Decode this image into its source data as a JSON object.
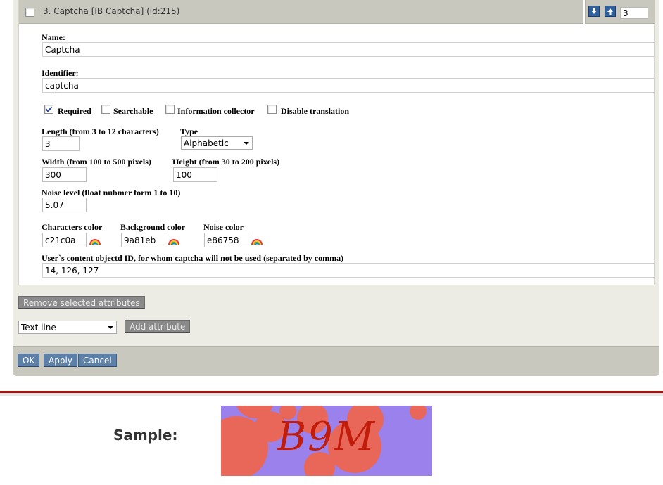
{
  "attribute": {
    "title": "3. Captcha [IB Captcha] (id:215)",
    "placement": "3",
    "move_down_icon": "arrow-down-icon",
    "move_up_icon": "arrow-up-icon"
  },
  "fields": {
    "name_label": "Name:",
    "name_value": "Captcha",
    "identifier_label": "Identifier:",
    "identifier_value": "captcha",
    "required_label": "Required",
    "searchable_label": "Searchable",
    "info_collector_label": "Information collector",
    "disable_translation_label": "Disable translation",
    "length_label": "Length (from 3 to 12 characters)",
    "length_value": "3",
    "type_label": "Type",
    "type_value": "Alphabetic",
    "width_label": "Width (from 100 to 500 pixels)",
    "width_value": "300",
    "height_label": "Height (from 30 to 200 pixels)",
    "height_value": "100",
    "noise_label": "Noise level (float nubmer form 1 to 10)",
    "noise_value": "5.07",
    "char_color_label": "Characters color",
    "char_color_value": "c21c0a",
    "bg_color_label": "Background color",
    "bg_color_value": "9a81eb",
    "noise_color_label": "Noise color",
    "noise_color_value": "e86758",
    "exclude_label": "User`s content objectd ID, for whom captcha will not be used (separated by comma)",
    "exclude_value": "14, 126, 127"
  },
  "actions": {
    "remove_selected": "Remove selected attributes",
    "datatype_select": "Text line",
    "add_attribute": "Add attribute",
    "ok": "OK",
    "apply": "Apply",
    "cancel": "Cancel"
  },
  "sample": {
    "label": "Sample:",
    "captcha_text": "B9M"
  },
  "colors": {
    "char_color": "#c21c0a",
    "bg_color": "#9a81eb",
    "noise_color": "#e86758",
    "accent_red": "#b00d0d"
  }
}
